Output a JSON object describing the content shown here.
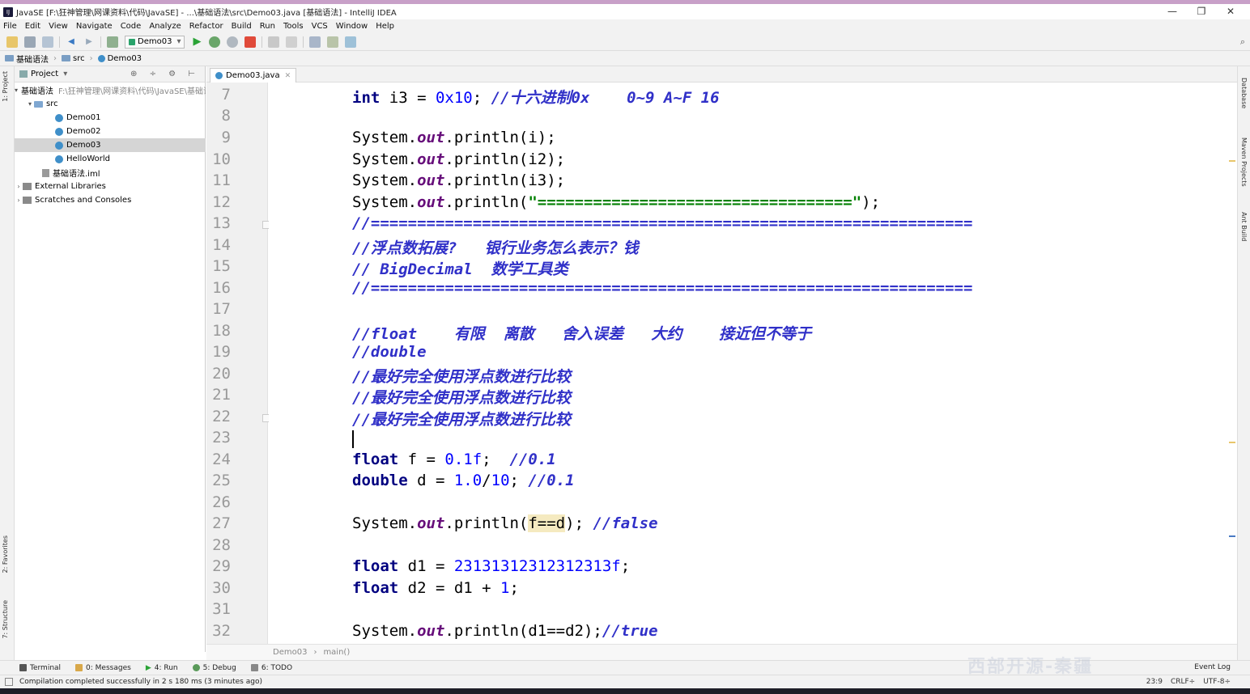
{
  "window": {
    "title": "JavaSE [F:\\狂神管理\\网课资料\\代码\\JavaSE] - ...\\基础语法\\src\\Demo03.java [基础语法] - IntelliJ IDEA",
    "minimize": "—",
    "restore": "❐",
    "close": "✕"
  },
  "menu": [
    "File",
    "Edit",
    "View",
    "Navigate",
    "Code",
    "Analyze",
    "Refactor",
    "Build",
    "Run",
    "Tools",
    "VCS",
    "Window",
    "Help"
  ],
  "toolbar": {
    "run_config": "Demo03",
    "search_icon": "⌕"
  },
  "breadcrumbs": [
    "基础语法",
    "src",
    "Demo03"
  ],
  "project_panel": {
    "title": "Project",
    "tools": "⊕ ÷ ⚙ ⊢",
    "tree": [
      {
        "label": "基础语法",
        "path": "F:\\狂神管理\\网课资料\\代码\\JavaSE\\基础语法"
      },
      {
        "label": "src"
      },
      {
        "label": "Demo01"
      },
      {
        "label": "Demo02"
      },
      {
        "label": "Demo03"
      },
      {
        "label": "HelloWorld"
      },
      {
        "label": "基础语法.iml"
      },
      {
        "label": "External Libraries"
      },
      {
        "label": "Scratches and Consoles"
      }
    ]
  },
  "left_tabs": {
    "project": "1: Project",
    "favorites": "2: Favorites",
    "structure": "7: Structure"
  },
  "right_tabs": {
    "database": "Database",
    "maven": "Maven Projects",
    "ant": "Ant Build"
  },
  "editor": {
    "tab": "Demo03.java",
    "line_numbers": [
      "7",
      "8",
      "9",
      "10",
      "11",
      "12",
      "13",
      "14",
      "15",
      "16",
      "17",
      "18",
      "19",
      "20",
      "21",
      "22",
      "23",
      "24",
      "25",
      "26",
      "27",
      "28",
      "29",
      "30",
      "31",
      "32"
    ],
    "code": {
      "l7_kw": "int",
      "l7_a": " i3 = ",
      "l7_num": "0x10",
      "l7_b": "; ",
      "l7_cm": "//十六进制0x    0~9 A~F 16",
      "sys": "System.",
      "out": "out",
      "l9_tail": ".println(i);",
      "l10_tail": ".println(i2);",
      "l11_tail": ".println(i3);",
      "l12_a": ".println(",
      "l12_str": "\"==================================\"",
      "l12_b": ");",
      "l13": "//=================================================================",
      "l14": "//浮点数拓展?   银行业务怎么表示？钱",
      "l15": "// BigDecimal  数学工具类",
      "l16": "//=================================================================",
      "l18": "//float    有限  离散   舍入误差   大约    接近但不等于",
      "l19": "//double",
      "l20": "//最好完全使用浮点数进行比较",
      "l21": "//最好完全使用浮点数进行比较",
      "l22": "//最好完全使用浮点数进行比较",
      "l24_kw": "float",
      "l24_a": " f = ",
      "l24_num": "0.1f",
      "l24_b": ";  ",
      "l24_cm": "//0.1",
      "l25_kw": "double",
      "l25_a": " d = ",
      "l25_num1": "1.0",
      "l25_slash": "/",
      "l25_num2": "10",
      "l25_b": "; ",
      "l25_cm": "//0.1",
      "l27_a": ".println(",
      "l27_hl": "f==d",
      "l27_b": "); ",
      "l27_cm": "//false",
      "l29_kw": "float",
      "l29_a": " d1 = ",
      "l29_num": "23131312312312313f",
      "l29_b": ";",
      "l30_kw": "float",
      "l30_a": " d2 = d1 + ",
      "l30_num": "1",
      "l30_b": ";",
      "l32_a": ".println(d1==d2);",
      "l32_cm": "//true"
    },
    "path_crumbs": [
      "Demo03",
      "›",
      "main()"
    ]
  },
  "bottom_tools": [
    "Terminal",
    "0: Messages",
    "4: Run",
    "5: Debug",
    "6: TODO"
  ],
  "event_log": "Event Log",
  "status": {
    "message": "Compilation completed successfully in 2 s 180 ms (3 minutes ago)",
    "position": "23:9",
    "line_sep": "CRLF÷",
    "encoding": "UTF-8÷"
  },
  "watermark": "西部开源-秦疆"
}
